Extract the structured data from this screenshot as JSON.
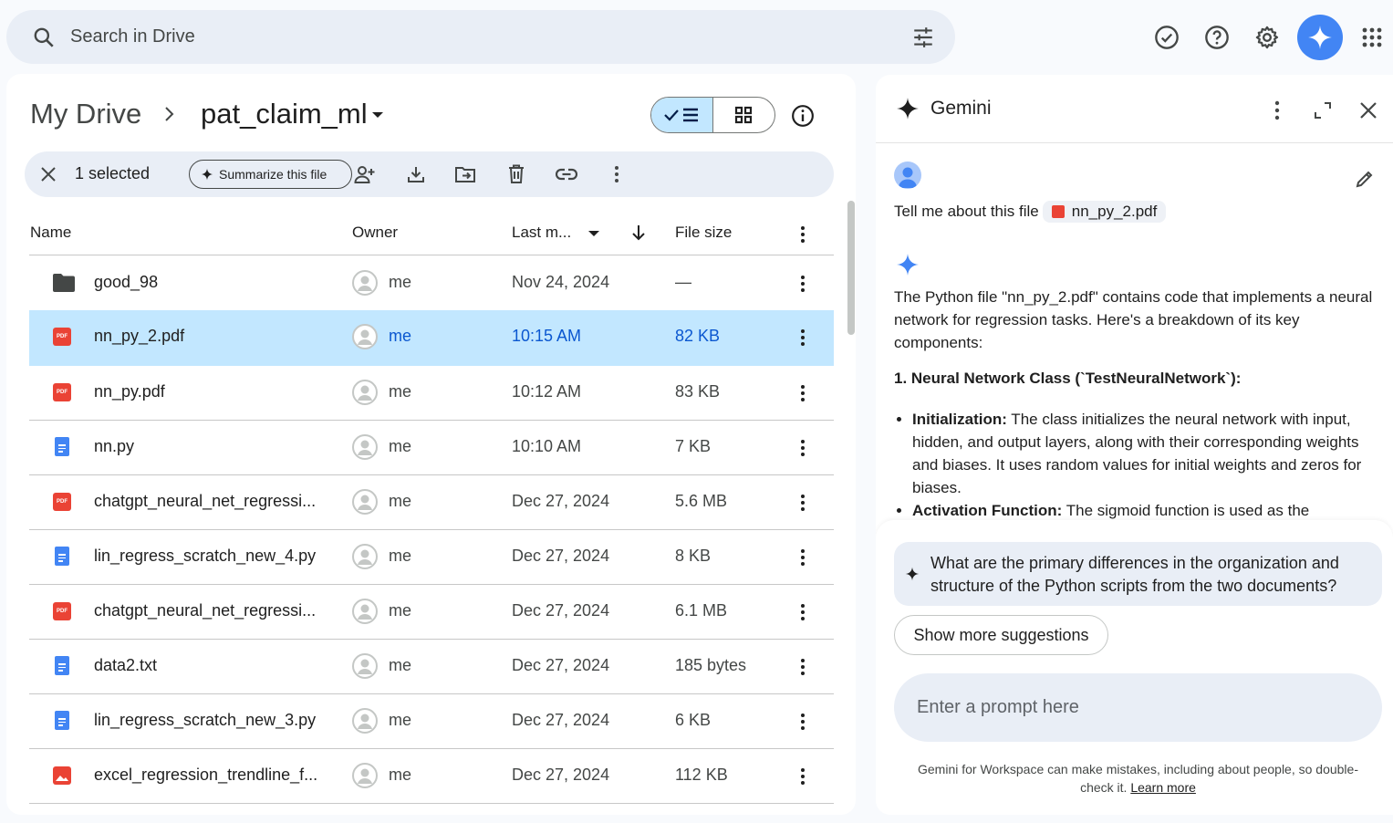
{
  "search": {
    "placeholder": "Search in Drive"
  },
  "header_icons": [
    "tune-icon",
    "ready-for-offline-icon",
    "help-icon",
    "settings-icon",
    "gemini-icon",
    "apps-icon"
  ],
  "breadcrumb": {
    "root": "My Drive",
    "current": "pat_claim_ml"
  },
  "selection_bar": {
    "count_label": "1 selected",
    "summarize_label": "Summarize this file"
  },
  "columns": {
    "name": "Name",
    "owner": "Owner",
    "modified": "Last m...",
    "size": "File size"
  },
  "files": [
    {
      "type": "folder",
      "name": "good_98",
      "owner": "me",
      "modified": "Nov 24, 2024",
      "size": "—",
      "selected": false
    },
    {
      "type": "pdf",
      "name": "nn_py_2.pdf",
      "owner": "me",
      "modified": "10:15 AM",
      "size": "82 KB",
      "selected": true
    },
    {
      "type": "pdf",
      "name": "nn_py.pdf",
      "owner": "me",
      "modified": "10:12 AM",
      "size": "83 KB",
      "selected": false
    },
    {
      "type": "doc",
      "name": "nn.py",
      "owner": "me",
      "modified": "10:10 AM",
      "size": "7 KB",
      "selected": false
    },
    {
      "type": "pdf",
      "name": "chatgpt_neural_net_regressi...",
      "owner": "me",
      "modified": "Dec 27, 2024",
      "size": "5.6 MB",
      "selected": false
    },
    {
      "type": "doc",
      "name": "lin_regress_scratch_new_4.py",
      "owner": "me",
      "modified": "Dec 27, 2024",
      "size": "8 KB",
      "selected": false
    },
    {
      "type": "pdf",
      "name": "chatgpt_neural_net_regressi...",
      "owner": "me",
      "modified": "Dec 27, 2024",
      "size": "6.1 MB",
      "selected": false
    },
    {
      "type": "doc",
      "name": "data2.txt",
      "owner": "me",
      "modified": "Dec 27, 2024",
      "size": "185 bytes",
      "selected": false
    },
    {
      "type": "doc",
      "name": "lin_regress_scratch_new_3.py",
      "owner": "me",
      "modified": "Dec 27, 2024",
      "size": "6 KB",
      "selected": false
    },
    {
      "type": "image",
      "name": "excel_regression_trendline_f...",
      "owner": "me",
      "modified": "Dec 27, 2024",
      "size": "112 KB",
      "selected": false
    }
  ],
  "gemini": {
    "title": "Gemini",
    "user_message": "Tell me about this file",
    "file_chip": "nn_py_2.pdf",
    "response_intro": "The Python file \"nn_py_2.pdf\" contains code that implements a neural network for regression tasks. Here's a breakdown of its key components:",
    "section_heading": "1. Neural Network Class (`TestNeuralNetwork`):",
    "bullets": [
      {
        "term": "Initialization:",
        "text": " The class initializes the neural network with input, hidden, and output layers, along with their corresponding weights and biases. It uses random values for initial weights and zeros for biases."
      },
      {
        "term": "Activation Function:",
        "text": " The sigmoid function is used as the"
      }
    ],
    "suggestion": "What are the primary differences in the organization and structure of the Python scripts from the two documents?",
    "more_suggestions": "Show more suggestions",
    "prompt_placeholder": "Enter a prompt here",
    "disclaimer": "Gemini for Workspace can make mistakes, including about people, so double-check it.",
    "learn_more": "Learn more"
  },
  "colors": {
    "accent": "#0b57d0",
    "selected_row": "#c2e7ff",
    "gemini_blue": "#4285f4",
    "pdf_red": "#ea4335"
  }
}
